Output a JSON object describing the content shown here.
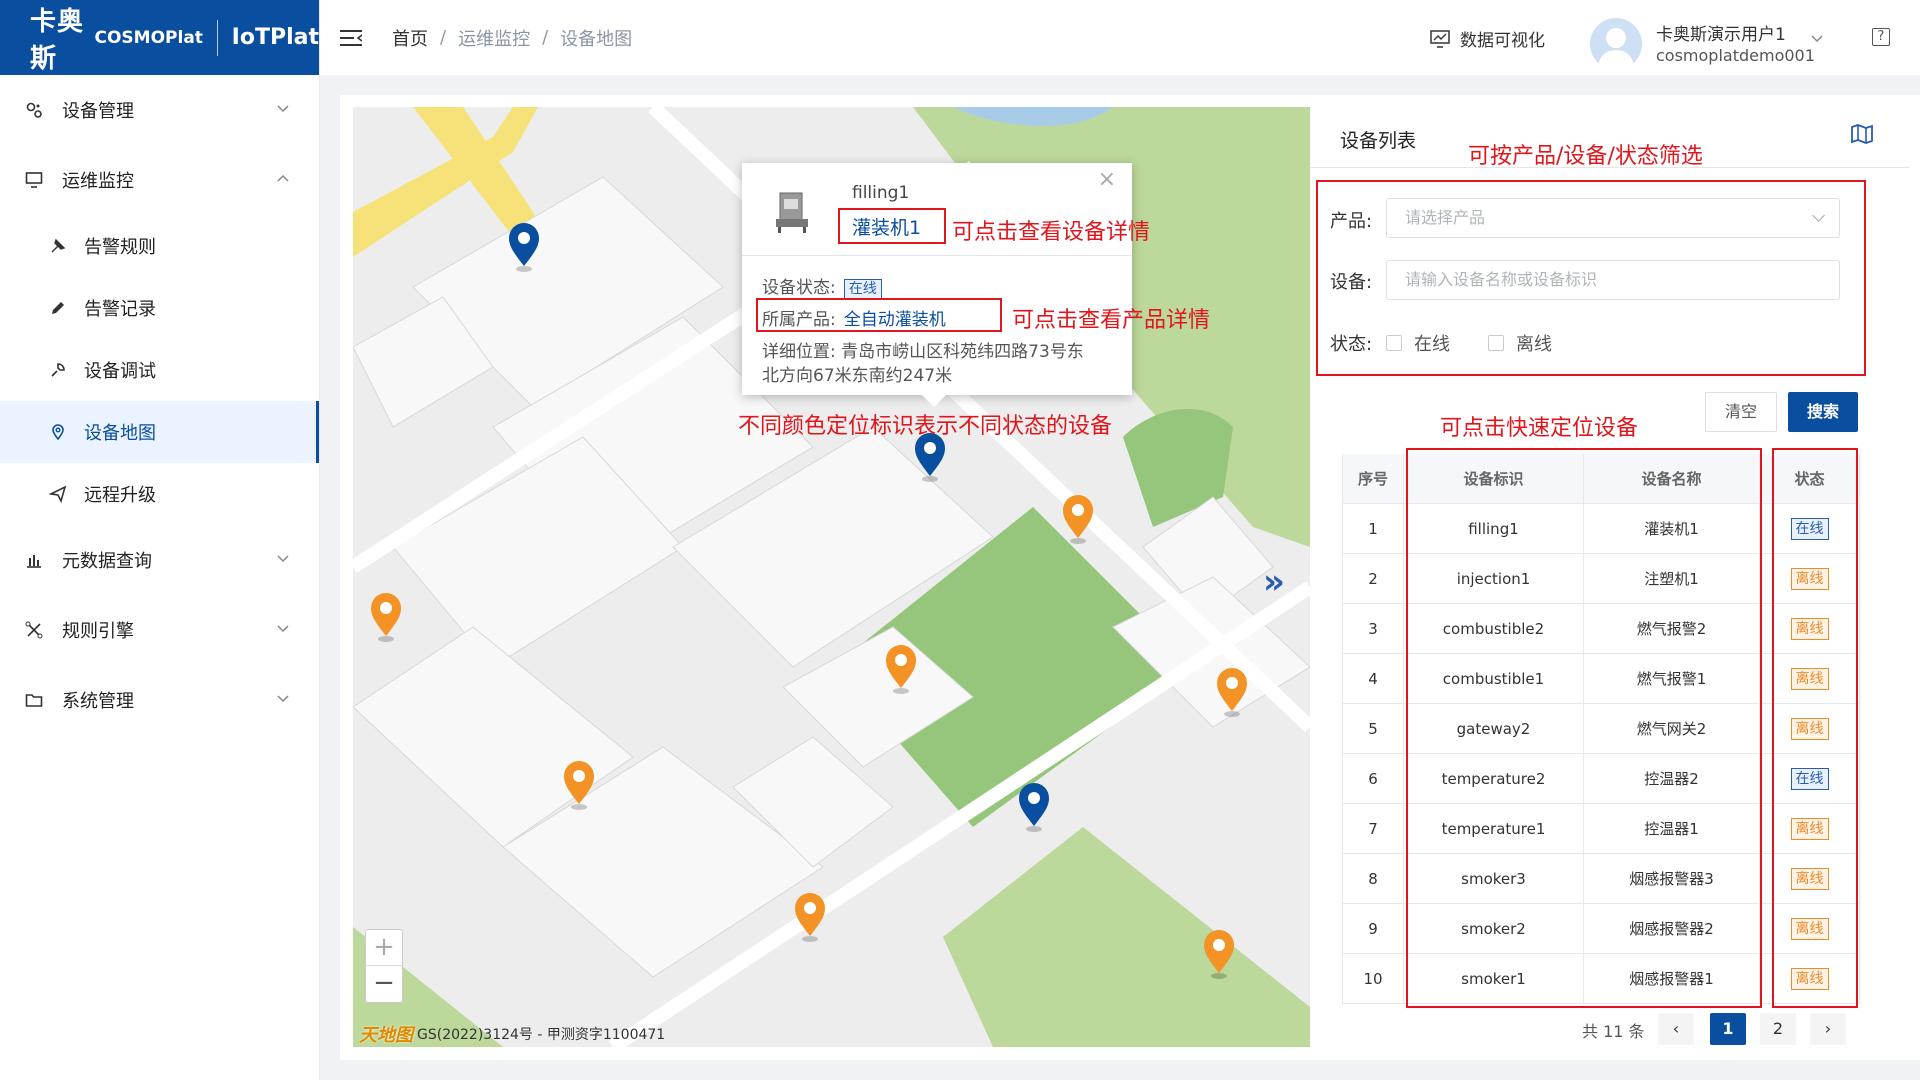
{
  "brand": {
    "name_cn": "卡奥斯",
    "cosmo": "COSMOPlat",
    "iot": "IoTPlat"
  },
  "sidebar": {
    "items": [
      {
        "label": "设备管理",
        "icon": "gear-icon",
        "expanded": false
      },
      {
        "label": "运维监控",
        "icon": "monitor-icon",
        "expanded": true,
        "children": [
          {
            "label": "告警规则",
            "icon": "pin-rule-icon"
          },
          {
            "label": "告警记录",
            "icon": "pen-icon"
          },
          {
            "label": "设备调试",
            "icon": "debug-icon"
          },
          {
            "label": "设备地图",
            "icon": "location-icon",
            "active": true
          },
          {
            "label": "远程升级",
            "icon": "send-icon"
          }
        ]
      },
      {
        "label": "元数据查询",
        "icon": "bar-chart-icon",
        "expanded": false
      },
      {
        "label": "规则引擎",
        "icon": "rule-engine-icon",
        "expanded": false
      },
      {
        "label": "系统管理",
        "icon": "folder-icon",
        "expanded": false
      }
    ]
  },
  "header": {
    "breadcrumb": [
      "首页",
      "运维监控",
      "设备地图"
    ],
    "dataviz": "数据可视化",
    "user_name": "卡奥斯演示用户1",
    "user_id": "cosmoplatdemo001"
  },
  "popup": {
    "code": "filling1",
    "name": "灌装机1",
    "status_label": "设备状态:",
    "status_value": "在线",
    "product_label": "所属产品:",
    "product_value": "全自动灌装机",
    "location_label": "详细位置:",
    "location_line1": "青岛市崂山区科苑纬四路73号东",
    "location_line2": "北方向67米东南约247米"
  },
  "map": {
    "credit_logo": "天地图",
    "credit": "GS(2022)3124号 - 甲测资字1100471",
    "zoom_in": "+",
    "zoom_out": "−",
    "expand": "»"
  },
  "annotations": {
    "device_detail": "可点击查看设备详情",
    "product_detail": "可点击查看产品详情",
    "pin_colors": "不同颜色定位标识表示不同状态的设备",
    "filter": "可按产品/设备/状态筛选",
    "locate": "可点击快速定位设备"
  },
  "panel": {
    "title": "设备列表",
    "product_label": "产品:",
    "product_placeholder": "请选择产品",
    "device_label": "设备:",
    "device_placeholder": "请输入设备名称或设备标识",
    "status_label": "状态:",
    "status_online": "在线",
    "status_offline": "离线",
    "clear": "清空",
    "search": "搜索"
  },
  "table": {
    "headers": [
      "序号",
      "设备标识",
      "设备名称",
      "状态"
    ],
    "rows": [
      [
        "1",
        "filling1",
        "灌装机1",
        "在线"
      ],
      [
        "2",
        "injection1",
        "注塑机1",
        "离线"
      ],
      [
        "3",
        "combustible2",
        "燃气报警2",
        "离线"
      ],
      [
        "4",
        "combustible1",
        "燃气报警1",
        "离线"
      ],
      [
        "5",
        "gateway2",
        "燃气网关2",
        "离线"
      ],
      [
        "6",
        "temperature2",
        "控温器2",
        "在线"
      ],
      [
        "7",
        "temperature1",
        "控温器1",
        "离线"
      ],
      [
        "8",
        "smoker3",
        "烟感报警器3",
        "离线"
      ],
      [
        "9",
        "smoker2",
        "烟感报警器2",
        "离线"
      ],
      [
        "10",
        "smoker1",
        "烟感报警器1",
        "离线"
      ]
    ]
  },
  "pagination": {
    "total": "共 11 条",
    "prev": "‹",
    "next": "›",
    "pages": [
      "1",
      "2"
    ],
    "current": "1"
  },
  "colors": {
    "brand": "#0a4ea0",
    "online_pin": "#0a4ea0",
    "offline_pin": "#f39325",
    "annotation": "#e0161c"
  }
}
